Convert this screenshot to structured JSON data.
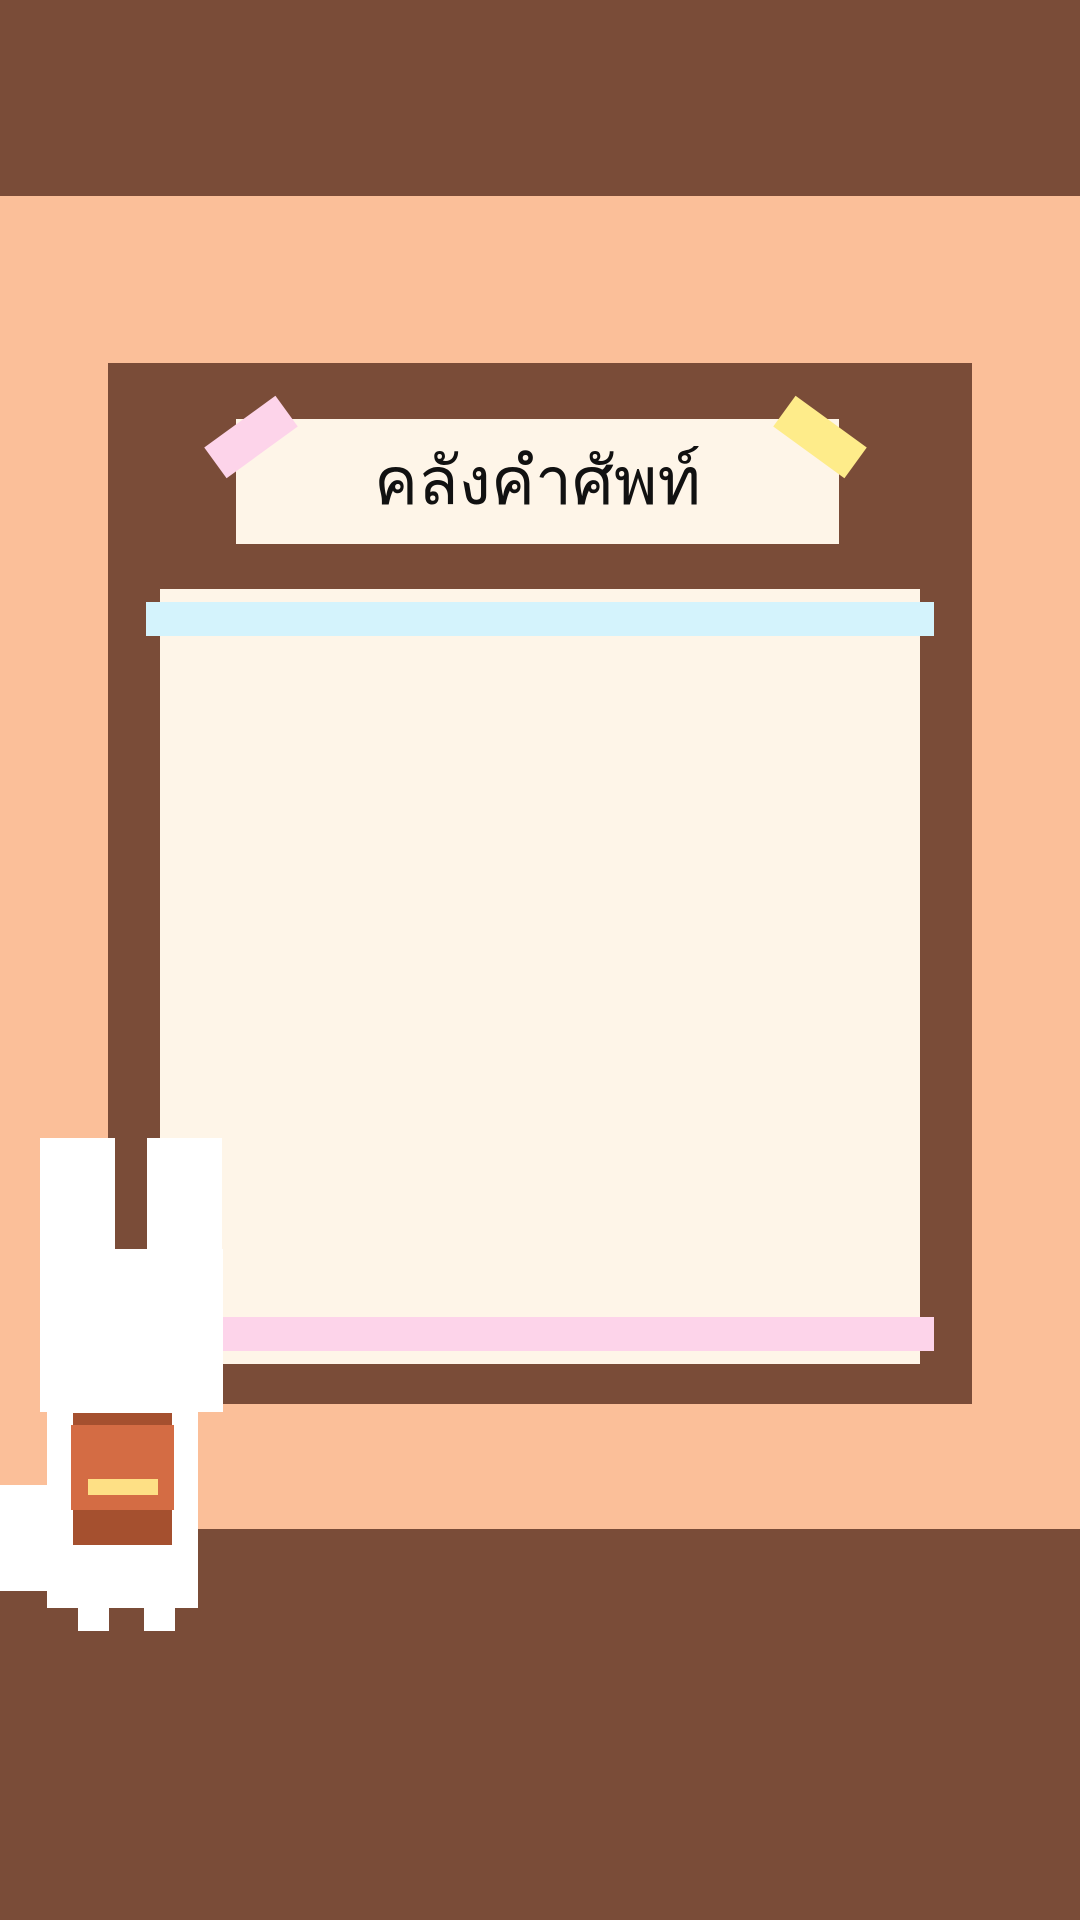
{
  "title": "คลังคำศัพท์",
  "icons": {
    "tape_left": "washi-tape-pink",
    "tape_right": "washi-tape-yellow",
    "mascot": "white-bunny-with-backpack"
  },
  "colors": {
    "dark_brown": "#7A4C38",
    "peach": "#FBBF99",
    "cream": "#FEF5E8",
    "tape_pink": "#FDD4EA",
    "tape_yellow": "#FEEC8A",
    "tape_blue": "#D4F3FC",
    "bag_orange": "#D46C44",
    "bag_brown": "#A5502F"
  }
}
